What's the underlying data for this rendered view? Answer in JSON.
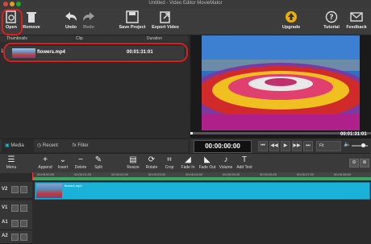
{
  "window": {
    "title": "Untitled - Video Editor MovieMator"
  },
  "toolbar": {
    "open": "Open",
    "remove": "Remove",
    "undo": "Undo",
    "redo": "Redo",
    "save_project": "Save Project",
    "export_video": "Export Video",
    "upgrade": "Upgrade",
    "tutorial": "Tutorial",
    "feedback": "Feedback"
  },
  "media": {
    "columns": {
      "thumbnails": "Thumbnails",
      "clip": "Clip",
      "duration": "Duration"
    },
    "items": [
      {
        "index": "1",
        "name": "flowers.mp4",
        "duration": "00:01:31:01"
      }
    ],
    "tabs": {
      "media": "Media",
      "recent": "Recent",
      "filter": "Filter"
    }
  },
  "player": {
    "timecode": "00:00:00:00",
    "duration": "00:01:31:01",
    "zoom": "Fit"
  },
  "timeline": {
    "tools": {
      "menu": "Menu",
      "append": "Append",
      "insert": "Insert",
      "delete": "Delete",
      "split": "Split",
      "resize": "Resize",
      "rotate": "Rotate",
      "crop": "Crop",
      "fade_in": "Fade In",
      "fade_out": "Fade Out",
      "volume": "Volume",
      "add_text": "Add Text"
    },
    "ruler_ticks": [
      "00:00:00:00",
      "00:00:01:00",
      "00:00:02:00",
      "00:00:03:00",
      "00:00:04:00",
      "00:00:05:00",
      "00:00:06:00",
      "00:00:07:00",
      "00:00:08:00"
    ],
    "tracks": [
      {
        "label": "V2",
        "clip": "flowers.mp4"
      },
      {
        "label": "V1",
        "clip": ""
      },
      {
        "label": "A1",
        "clip": ""
      },
      {
        "label": "A2",
        "clip": ""
      }
    ]
  },
  "colors": {
    "accent": "#1ab2d8",
    "annotation": "#d62020",
    "upgrade": "#e8b100"
  }
}
